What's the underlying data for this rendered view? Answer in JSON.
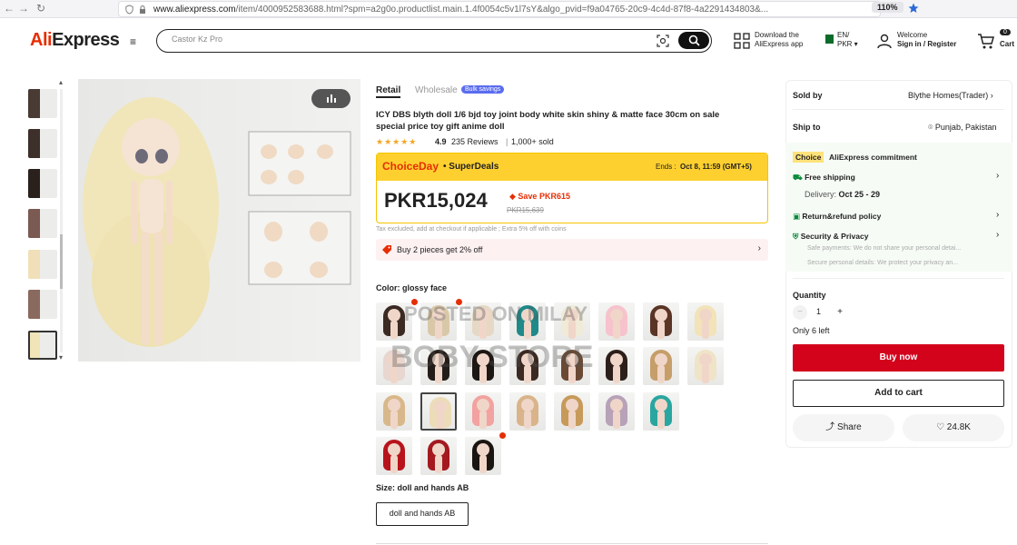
{
  "browser": {
    "url_prefix": "www.aliexpress.com",
    "url_rest": "/item/4000952583688.html?spm=a2g0o.productlist.main.1.4f0054c5v1l7sY&algo_pvid=f9a04765-20c9-4c4d-87f8-4a2291434803&...",
    "zoom": "110%"
  },
  "header": {
    "logo_a": "Ali",
    "logo_b": "Express",
    "search_value": "Castor Kz Pro",
    "download_line1": "Download the",
    "download_line2": "AliExpress app",
    "lang_line1": "EN/",
    "lang_line2": "PKR",
    "welcome_line1": "Welcome",
    "welcome_line2": "Sign in / Register",
    "cart_label": "Cart",
    "cart_count": "0"
  },
  "product": {
    "tab_retail": "Retail",
    "tab_wholesale": "Wholesale",
    "badge_bulk": "Bulk savings",
    "title": "ICY DBS blyth doll 1/6 bjd toy joint body white skin shiny & matte face 30cm on sale special price toy gift anime doll",
    "rating": "4.9",
    "reviews": "235 Reviews",
    "sold": "1,000+ sold",
    "choice_brand": "ChoiceDay",
    "choice_sub": "• SuperDeals",
    "ends_label": "Ends :",
    "ends_value": "Oct 8, 11:59 (GMT+5)",
    "price": "PKR15,024",
    "save": "Save PKR615",
    "old_price": "PKR15,639",
    "tax_note": "Tax excluded, add at checkout if applicable ; Extra 5% off with coins",
    "buy2": "Buy 2 pieces get 2% off",
    "color_label": "Color:",
    "color_value": "glossy face",
    "size_label": "Size:",
    "size_value": "doll and hands AB",
    "size_option": "doll and hands AB"
  },
  "watermark": {
    "line1": "POSTED ON MILAY",
    "line2": "BOBY STORE"
  },
  "panel": {
    "sold_by_label": "Sold by",
    "sold_by_value": "Blythe Homes(Trader)",
    "ship_to_label": "Ship to",
    "ship_to_value": "Punjab, Pakistan",
    "choice_tag": "Choice",
    "commitment": "AliExpress commitment",
    "free_shipping": "Free shipping",
    "delivery_label": "Delivery:",
    "delivery_value": "Oct 25 - 29",
    "refund": "Return&refund policy",
    "security": "Security & Privacy",
    "sec_line1": "Safe payments: We do not share your personal detai...",
    "sec_line2": "Secure personal details: We protect your privacy an...",
    "quantity_label": "Quantity",
    "quantity_value": "1",
    "left": "Only 6 left",
    "buy_now": "Buy now",
    "add_to_cart": "Add to cart",
    "share": "Share",
    "wishlist": "24.8K"
  },
  "colors": {
    "brand_red": "#e62e04",
    "buy_red": "#d3031c",
    "choice_yellow": "#fed02f"
  },
  "swatch_hair_colors": [
    "#3a2a22",
    "#d9c8a8",
    "#e6d8c4",
    "#1f8a8a",
    "#f0ead8",
    "#f6c3cc",
    "#5a3526",
    "#f2e3b8",
    "#e8d6d0",
    "#241c18",
    "#1d1714",
    "#3b2a22",
    "#6b4a35",
    "#2c1f1a",
    "#c69e6a",
    "#efe4c7",
    "#d8b88a",
    "#ecdcb8",
    "#f2a2a0",
    "#d9b48a",
    "#c79a5a",
    "#b7a2b8",
    "#2aa6a0",
    "#b8141c",
    "#a3191f",
    "#1b1512"
  ]
}
